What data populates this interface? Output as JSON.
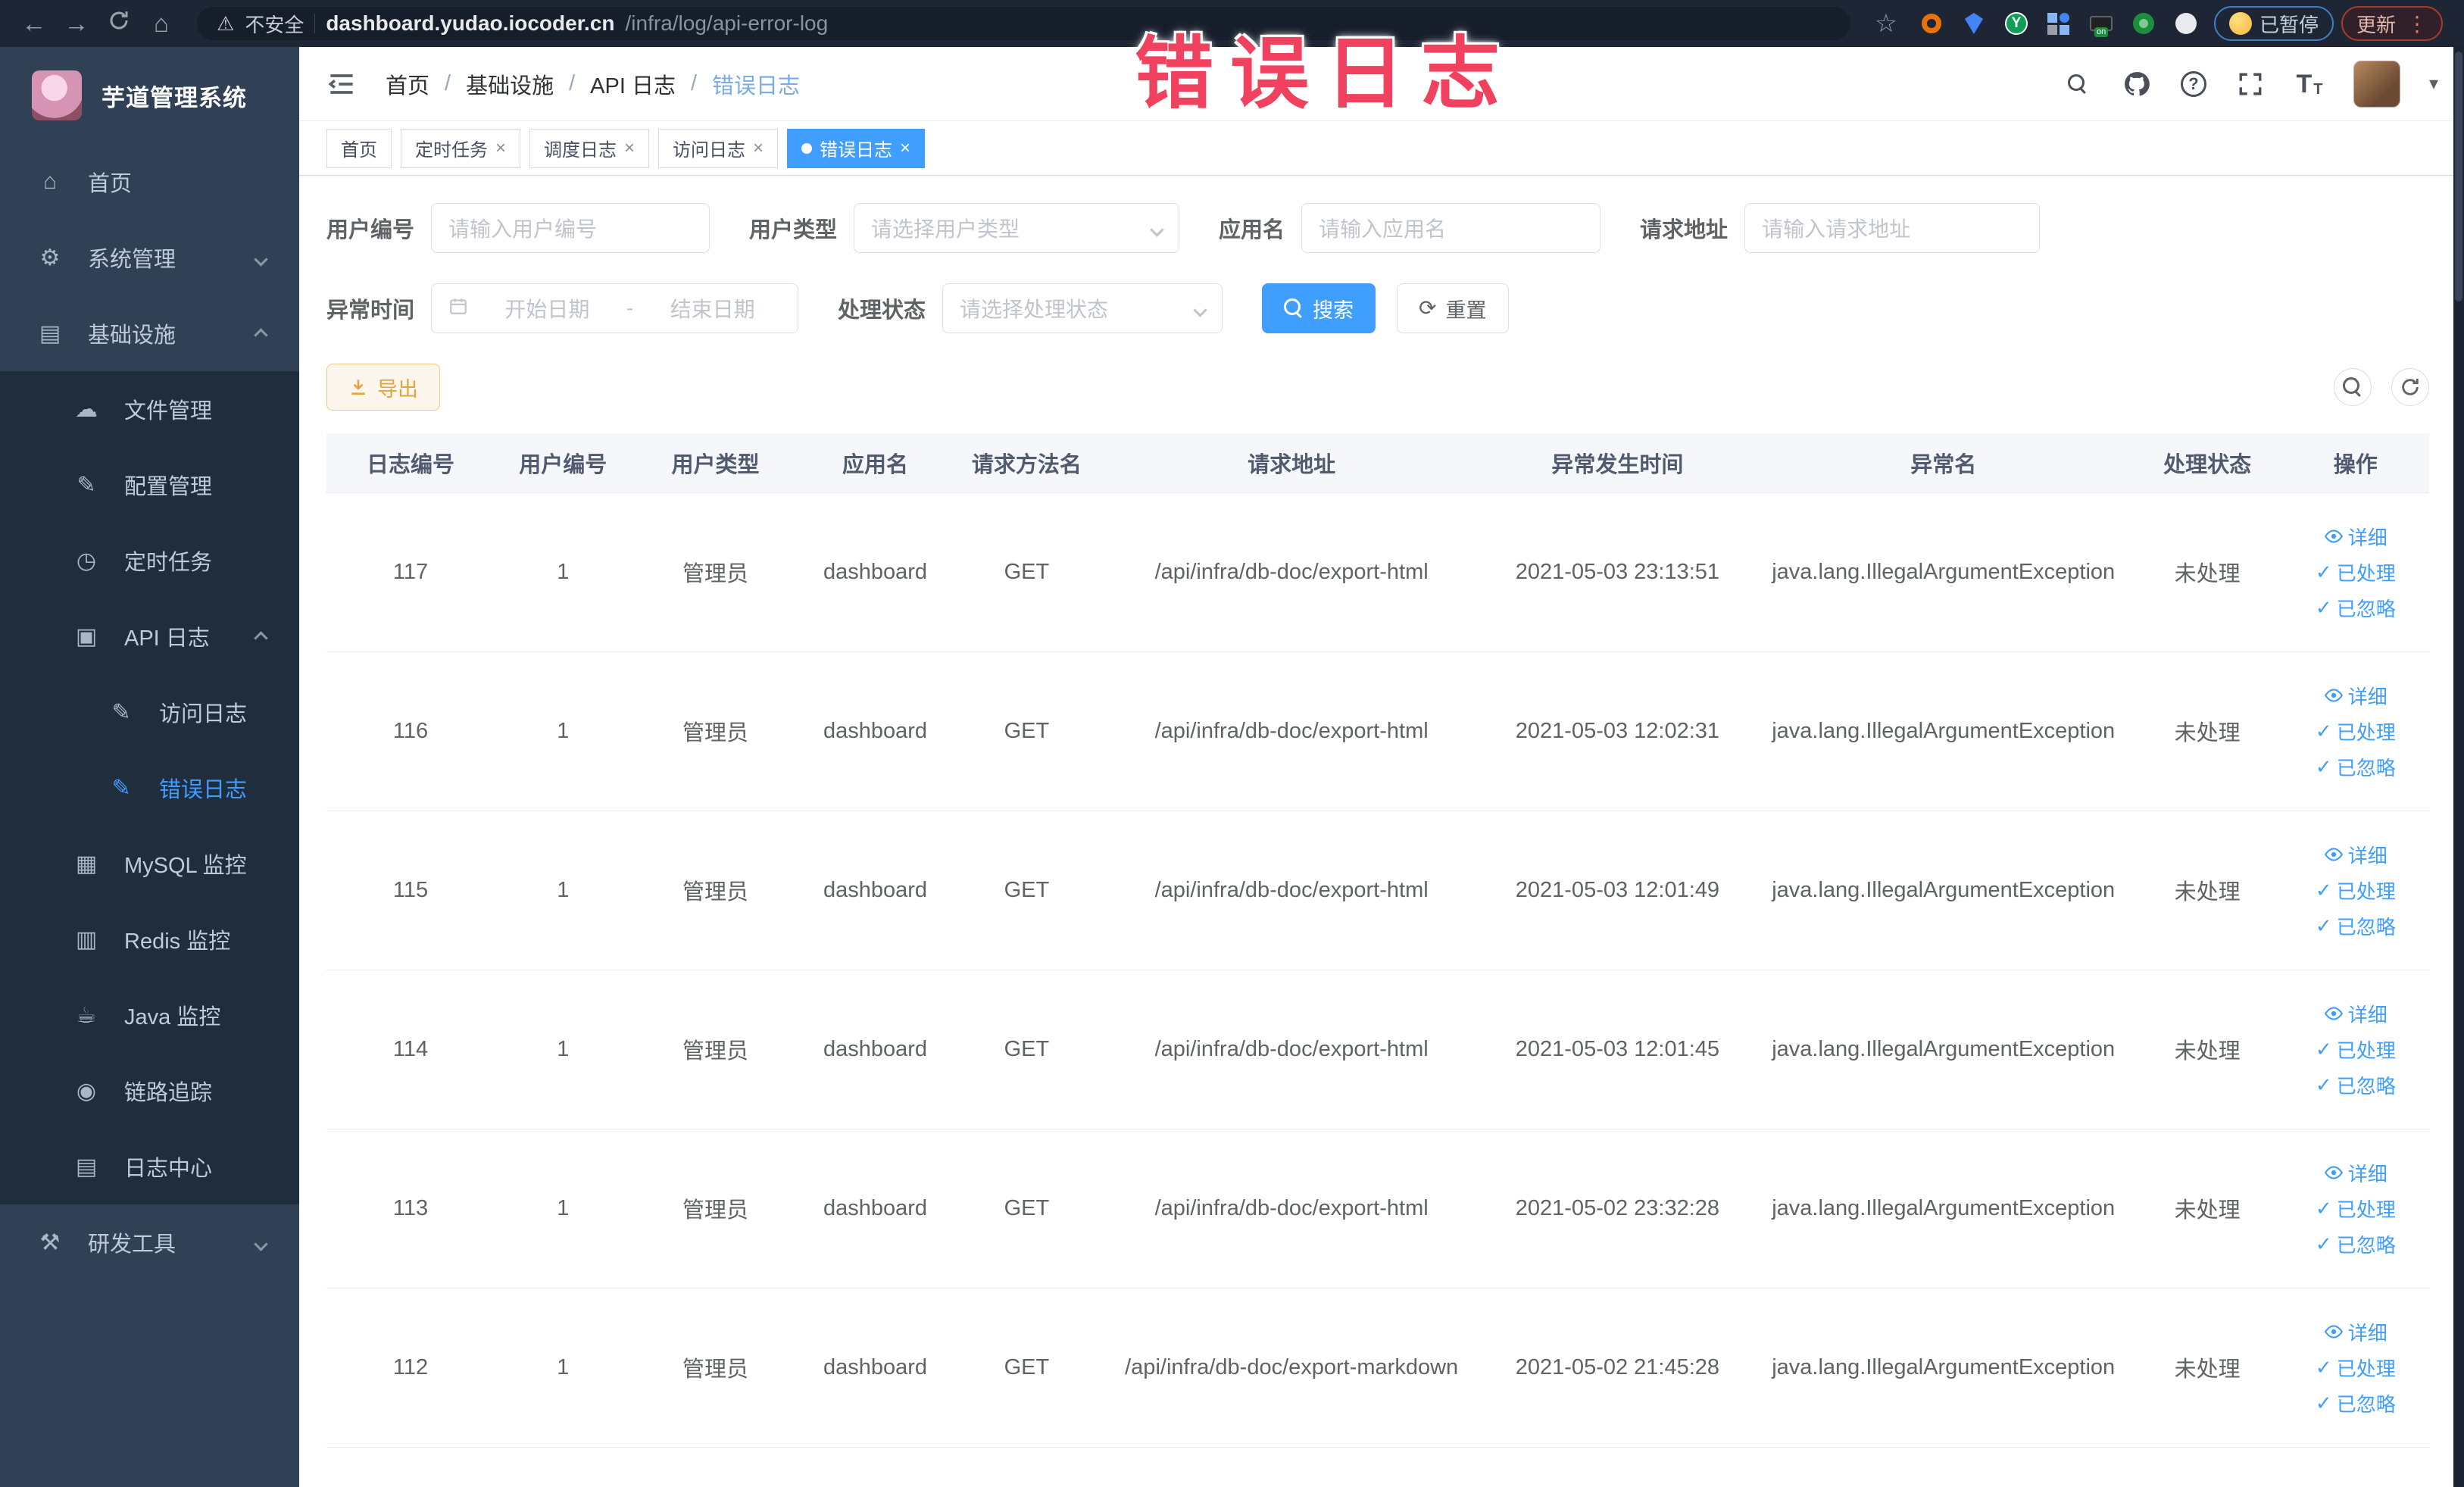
{
  "browser": {
    "security_label": "不安全",
    "url_domain": "dashboard.yudao.iocoder.cn",
    "url_path": "/infra/log/api-error-log",
    "paused_label": "已暂停",
    "update_label": "更新",
    "extensions": [
      "extension-orange-ring-icon",
      "extension-shield-icon",
      "extension-green-circle-icon",
      "extension-grid-icon",
      "extension-switch-on-icon",
      "extension-leaf-icon",
      "extension-paw-icon"
    ]
  },
  "annotation_text": "错误日志",
  "sidebar": {
    "title": "芋道管理系统",
    "items": [
      {
        "key": "home",
        "label": "首页",
        "icon": "home-icon",
        "level": 0
      },
      {
        "key": "system",
        "label": "系统管理",
        "icon": "gear-icon",
        "level": 0,
        "arrow": "down"
      },
      {
        "key": "infra",
        "label": "基础设施",
        "icon": "infra-icon",
        "level": 0,
        "arrow": "up"
      },
      {
        "key": "file",
        "label": "文件管理",
        "icon": "cloud-upload-icon",
        "level": 1
      },
      {
        "key": "config",
        "label": "配置管理",
        "icon": "edit-icon",
        "level": 1
      },
      {
        "key": "job",
        "label": "定时任务",
        "icon": "clock-icon",
        "level": 1
      },
      {
        "key": "api-log",
        "label": "API 日志",
        "icon": "api-log-icon",
        "level": 1,
        "arrow": "up"
      },
      {
        "key": "access-log",
        "label": "访问日志",
        "icon": "edit-icon",
        "level": 2
      },
      {
        "key": "error-log",
        "label": "错误日志",
        "icon": "edit-icon",
        "level": 2,
        "active": true
      },
      {
        "key": "mysql",
        "label": "MySQL 监控",
        "icon": "mysql-monitor-icon",
        "level": 1
      },
      {
        "key": "redis",
        "label": "Redis 监控",
        "icon": "redis-monitor-icon",
        "level": 1
      },
      {
        "key": "java",
        "label": "Java 监控",
        "icon": "java-monitor-icon",
        "level": 1
      },
      {
        "key": "trace",
        "label": "链路追踪",
        "icon": "trace-eye-icon",
        "level": 1
      },
      {
        "key": "log-center",
        "label": "日志中心",
        "icon": "log-center-icon",
        "level": 1
      },
      {
        "key": "dev-tools",
        "label": "研发工具",
        "icon": "tools-icon",
        "level": 0,
        "arrow": "down"
      }
    ]
  },
  "header": {
    "breadcrumb": [
      "首页",
      "基础设施",
      "API 日志",
      "错误日志"
    ]
  },
  "tabs": [
    {
      "label": "首页",
      "closable": false,
      "active": false
    },
    {
      "label": "定时任务",
      "closable": true,
      "active": false
    },
    {
      "label": "调度日志",
      "closable": true,
      "active": false
    },
    {
      "label": "访问日志",
      "closable": true,
      "active": false
    },
    {
      "label": "错误日志",
      "closable": true,
      "active": true
    }
  ],
  "filters": {
    "rows": [
      [
        {
          "key": "user-id",
          "label": "用户编号",
          "type": "input",
          "placeholder": "请输入用户编号"
        },
        {
          "key": "user-type",
          "label": "用户类型",
          "type": "select",
          "placeholder": "请选择用户类型"
        },
        {
          "key": "app-name",
          "label": "应用名",
          "type": "input",
          "placeholder": "请输入应用名"
        },
        {
          "key": "request-url",
          "label": "请求地址",
          "type": "input",
          "placeholder": "请输入请求地址"
        }
      ],
      [
        {
          "key": "exception-time",
          "label": "异常时间",
          "type": "daterange",
          "start_placeholder": "开始日期",
          "end_placeholder": "结束日期",
          "separator": "-"
        },
        {
          "key": "process-status",
          "label": "处理状态",
          "type": "select",
          "placeholder": "请选择处理状态"
        }
      ]
    ],
    "search_label": "搜索",
    "reset_label": "重置"
  },
  "toolbar": {
    "export_label": "导出"
  },
  "table": {
    "headers": [
      "日志编号",
      "用户编号",
      "用户类型",
      "应用名",
      "请求方法名",
      "请求地址",
      "异常发生时间",
      "异常名",
      "处理状态",
      "操作"
    ],
    "col_keys": [
      "id",
      "user_id",
      "user_type",
      "app_name",
      "method",
      "url",
      "time",
      "exception",
      "status"
    ],
    "row_actions": [
      "详细",
      "已处理",
      "已忽略"
    ],
    "rows": [
      {
        "id": "117",
        "user_id": "1",
        "user_type": "管理员",
        "app_name": "dashboard",
        "method": "GET",
        "url": "/api/infra/db-doc/export-html",
        "time": "2021-05-03 23:13:51",
        "exception": "java.lang.IllegalArgumentException",
        "status": "未处理"
      },
      {
        "id": "116",
        "user_id": "1",
        "user_type": "管理员",
        "app_name": "dashboard",
        "method": "GET",
        "url": "/api/infra/db-doc/export-html",
        "time": "2021-05-03 12:02:31",
        "exception": "java.lang.IllegalArgumentException",
        "status": "未处理"
      },
      {
        "id": "115",
        "user_id": "1",
        "user_type": "管理员",
        "app_name": "dashboard",
        "method": "GET",
        "url": "/api/infra/db-doc/export-html",
        "time": "2021-05-03 12:01:49",
        "exception": "java.lang.IllegalArgumentException",
        "status": "未处理"
      },
      {
        "id": "114",
        "user_id": "1",
        "user_type": "管理员",
        "app_name": "dashboard",
        "method": "GET",
        "url": "/api/infra/db-doc/export-html",
        "time": "2021-05-03 12:01:45",
        "exception": "java.lang.IllegalArgumentException",
        "status": "未处理"
      },
      {
        "id": "113",
        "user_id": "1",
        "user_type": "管理员",
        "app_name": "dashboard",
        "method": "GET",
        "url": "/api/infra/db-doc/export-html",
        "time": "2021-05-02 23:32:28",
        "exception": "java.lang.IllegalArgumentException",
        "status": "未处理"
      },
      {
        "id": "112",
        "user_id": "1",
        "user_type": "管理员",
        "app_name": "dashboard",
        "method": "GET",
        "url": "/api/infra/db-doc/export-markdown",
        "time": "2021-05-02 21:45:28",
        "exception": "java.lang.IllegalArgumentException",
        "status": "未处理"
      }
    ]
  },
  "colors": {
    "accent": "#409eff",
    "warning": "#e6a23c",
    "annotation": "#f0415f",
    "sidebar_bg": "#304156",
    "submenu_bg": "#1f2d3d",
    "chrome_bg": "#1e2635"
  }
}
